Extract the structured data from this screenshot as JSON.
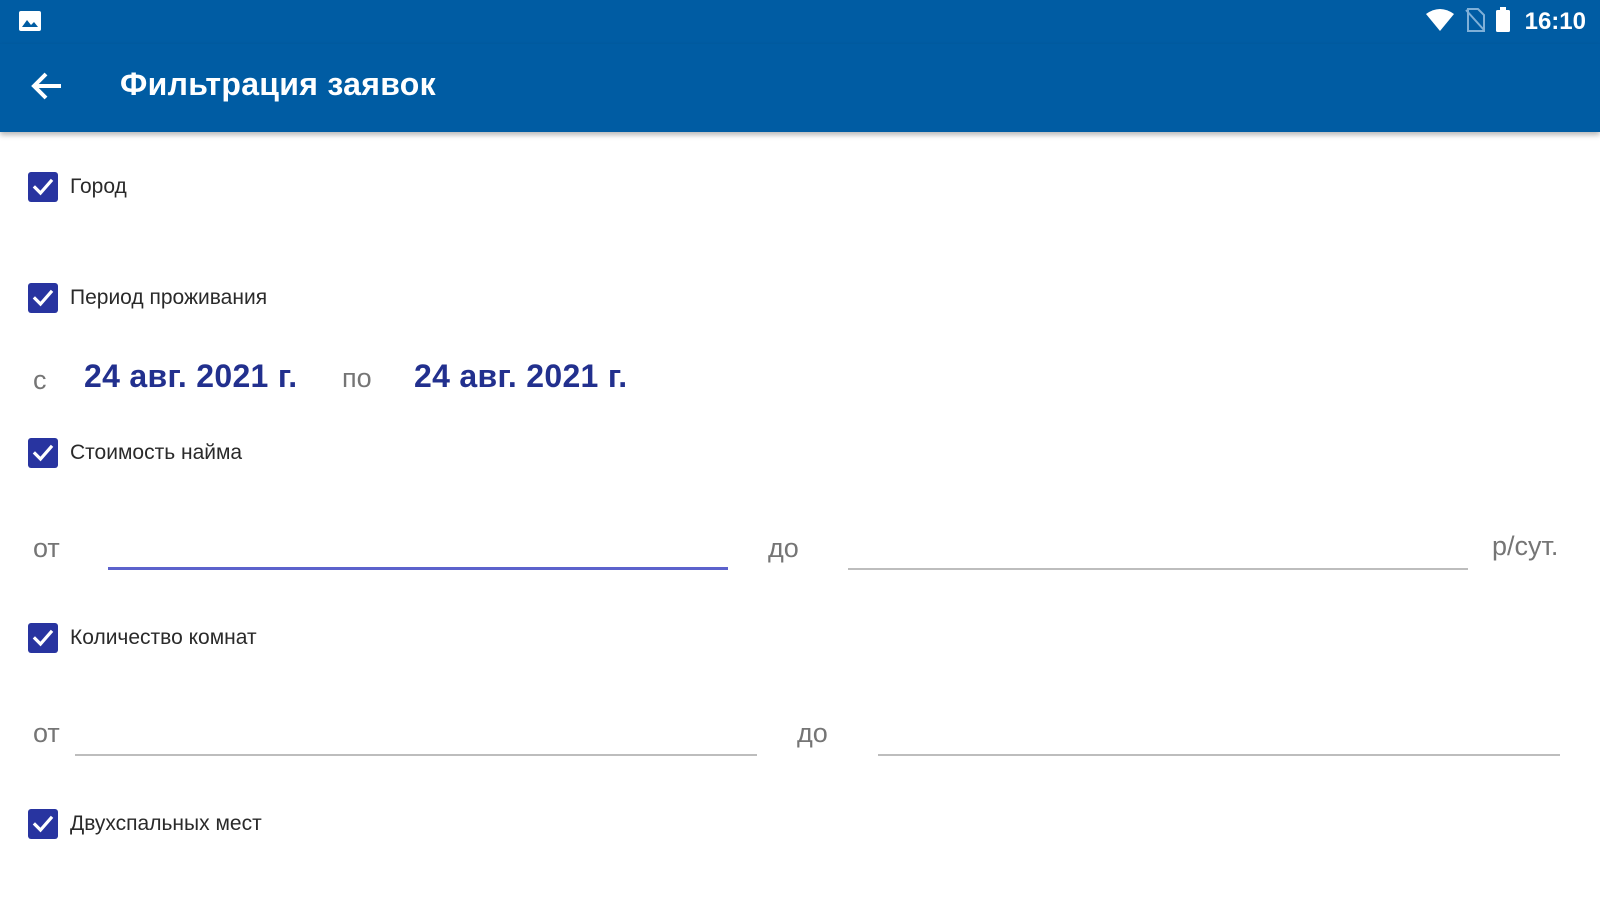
{
  "status_bar": {
    "time": "16:10",
    "icons": [
      "gallery-icon",
      "wifi-icon",
      "no-sim-icon",
      "battery-icon"
    ]
  },
  "app_bar": {
    "title": "Фильтрация заявок",
    "back_icon": "arrow-left-icon"
  },
  "filters": {
    "city": {
      "label": "Город",
      "checked": true
    },
    "period": {
      "label": "Период проживания",
      "checked": true,
      "from_label": "с",
      "from_date": "24 авг. 2021 г.",
      "to_label": "по",
      "to_date": "24 авг. 2021 г."
    },
    "price": {
      "label": "Стоимость найма",
      "checked": true,
      "from_label": "от",
      "from_value": "",
      "to_label": "до",
      "to_value": "",
      "unit": "р/сут."
    },
    "rooms": {
      "label": "Количество комнат",
      "checked": true,
      "from_label": "от",
      "from_value": "",
      "to_label": "до",
      "to_value": ""
    },
    "double_beds": {
      "label": "Двухспальных мест",
      "checked": true
    }
  },
  "colors": {
    "primary": "#005ca3",
    "checkbox": "#2834a0",
    "date_text": "#22308e",
    "focused_underline": "#5c62cc",
    "underline": "#bdbdbd"
  }
}
